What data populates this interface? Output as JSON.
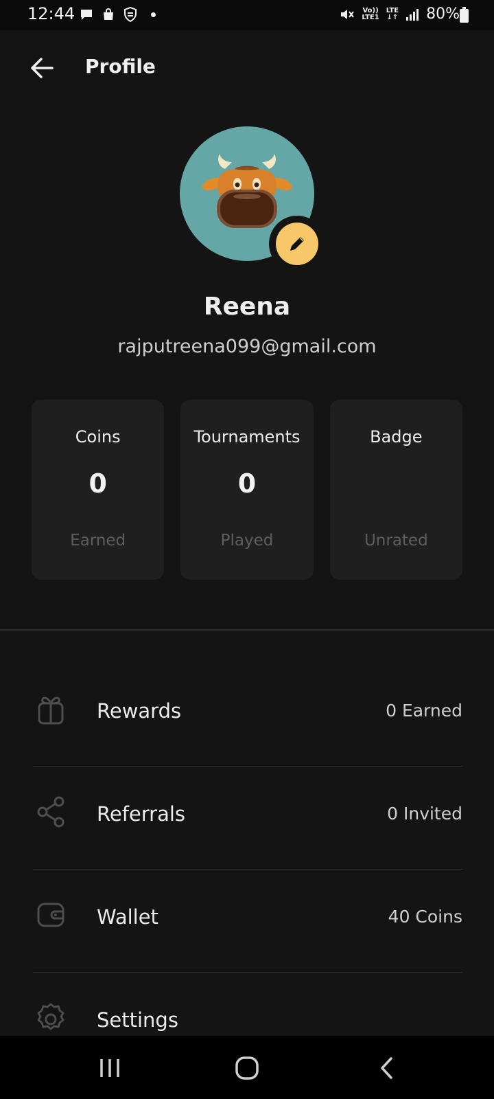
{
  "status_bar": {
    "time": "12:44",
    "volte_top": "Vo))",
    "volte_bottom": "LTE1",
    "network": "LTE",
    "battery": "80%"
  },
  "header": {
    "title": "Profile",
    "back_icon": "arrow-left-icon"
  },
  "profile": {
    "name": "Reena",
    "email": "rajputreena099@gmail.com",
    "avatar_icon": "bull-avatar",
    "edit_icon": "pencil-icon"
  },
  "stats": [
    {
      "label": "Coins",
      "value": "0",
      "sub": "Earned"
    },
    {
      "label": "Tournaments",
      "value": "0",
      "sub": "Played"
    },
    {
      "label": "Badge",
      "value": "",
      "sub": "Unrated"
    }
  ],
  "menu": [
    {
      "label": "Rewards",
      "value": "0 Earned",
      "icon": "gift-icon"
    },
    {
      "label": "Referrals",
      "value": "0 Invited",
      "icon": "share-icon"
    },
    {
      "label": "Wallet",
      "value": "40 Coins",
      "icon": "wallet-icon"
    },
    {
      "label": "Settings",
      "value": "",
      "icon": "gear-icon"
    }
  ],
  "colors": {
    "background": "#141414",
    "card": "#1f1f1f",
    "avatar_bg": "#64a7a6",
    "accent": "#f6c86a"
  }
}
